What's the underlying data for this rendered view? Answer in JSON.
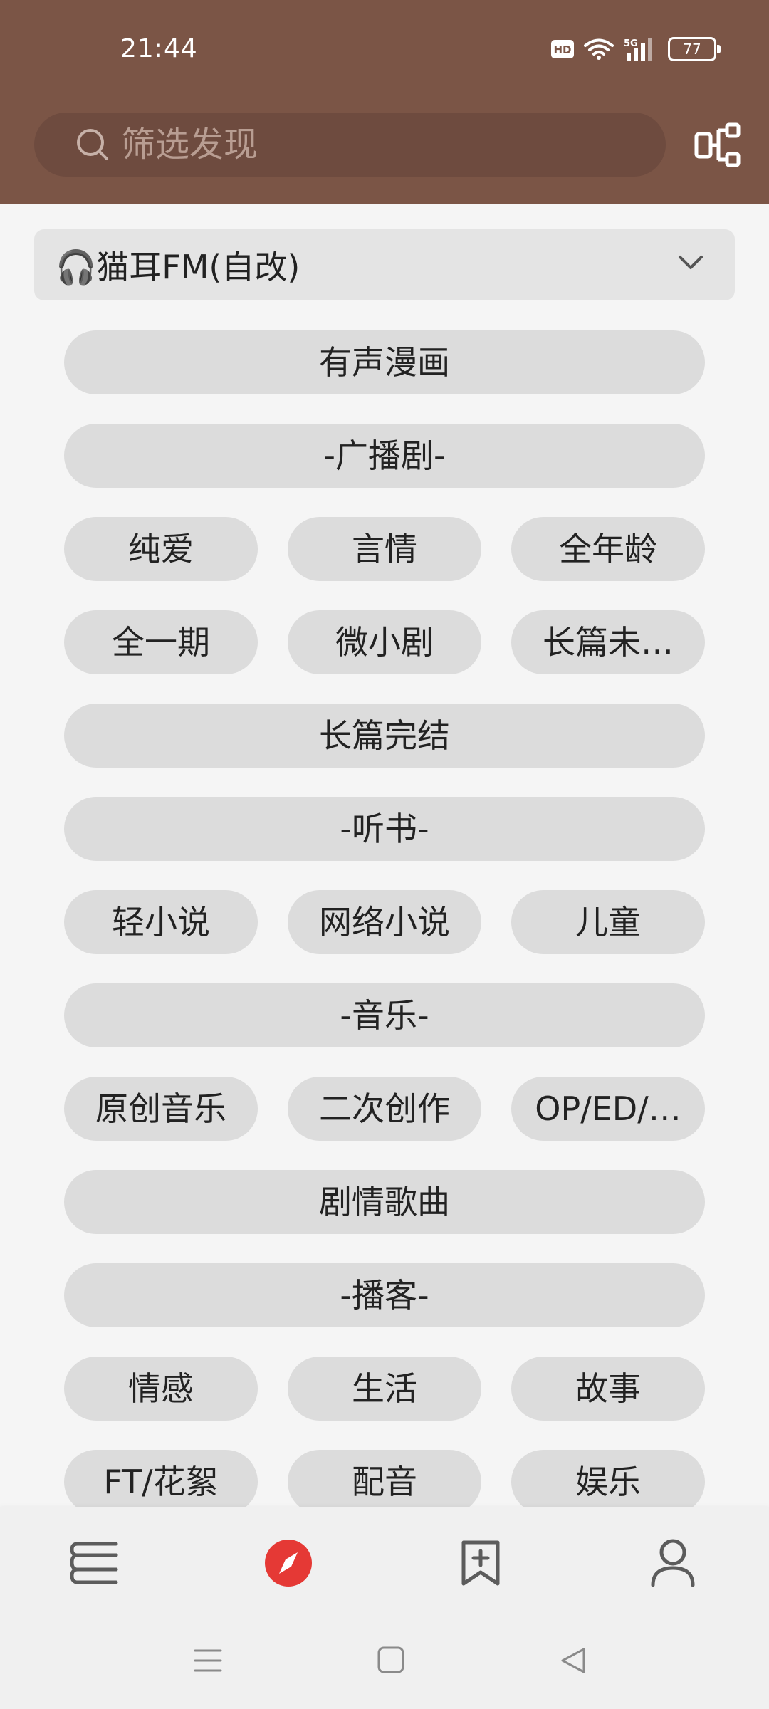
{
  "status_bar": {
    "time": "21:44",
    "hd": "HD",
    "network": "5G",
    "battery": "77"
  },
  "search": {
    "placeholder": "筛选发现"
  },
  "source": {
    "label": "🎧猫耳FM(自改)"
  },
  "tags": [
    {
      "label": "有声漫画",
      "layout": "full"
    },
    {
      "label": "-广播剧-",
      "layout": "full"
    },
    {
      "label": "纯爱",
      "layout": "c1"
    },
    {
      "label": "言情",
      "layout": "c2"
    },
    {
      "label": "全年龄",
      "layout": "c3"
    },
    {
      "label": "全一期",
      "layout": "c1"
    },
    {
      "label": "微小剧",
      "layout": "c2"
    },
    {
      "label": "长篇未…",
      "layout": "c3"
    },
    {
      "label": "长篇完结",
      "layout": "full"
    },
    {
      "label": "-听书-",
      "layout": "full"
    },
    {
      "label": "轻小说",
      "layout": "c1"
    },
    {
      "label": "网络小说",
      "layout": "c2"
    },
    {
      "label": "儿童",
      "layout": "c3"
    },
    {
      "label": "-音乐-",
      "layout": "full"
    },
    {
      "label": "原创音乐",
      "layout": "c1"
    },
    {
      "label": "二次创作",
      "layout": "c2"
    },
    {
      "label": "OP/ED/…",
      "layout": "c3"
    },
    {
      "label": "剧情歌曲",
      "layout": "full"
    },
    {
      "label": "-播客-",
      "layout": "full"
    },
    {
      "label": "情感",
      "layout": "c1"
    },
    {
      "label": "生活",
      "layout": "c2"
    },
    {
      "label": "故事",
      "layout": "c3"
    },
    {
      "label": "FT/花絮",
      "layout": "c1"
    },
    {
      "label": "配音",
      "layout": "c2"
    },
    {
      "label": "娱乐",
      "layout": "c3"
    }
  ],
  "bottom_nav": [
    {
      "icon": "bookshelf-icon",
      "active": false
    },
    {
      "icon": "compass-icon",
      "active": true
    },
    {
      "icon": "bookmark-add-icon",
      "active": false
    },
    {
      "icon": "person-icon",
      "active": false
    }
  ],
  "colors": {
    "header": "#7b5546",
    "active": "#e53935",
    "tag_bg": "#dcdcdc"
  }
}
